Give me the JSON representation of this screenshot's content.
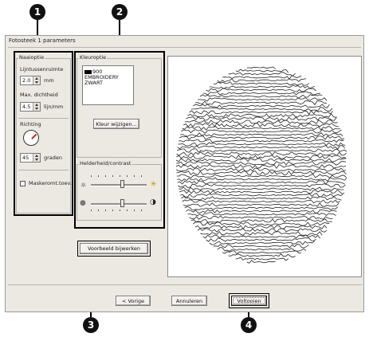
{
  "window": {
    "title": "Fotosteek 1 parameters"
  },
  "callouts": [
    "1",
    "2",
    "3",
    "4"
  ],
  "sewing": {
    "group_label": "Naaioptie",
    "line_spacing_label": "Lijntussenruimte",
    "line_spacing_value": "2.0",
    "line_spacing_unit": "mm",
    "max_density_label": "Max. dichtheid",
    "max_density_value": "4.5",
    "max_density_unit": "lijn/mm",
    "direction_label": "Richting",
    "angle_value": "45",
    "angle_unit": "graden",
    "mask_checkbox_label": "Maskeromt.toev.",
    "mask_checked": false
  },
  "color": {
    "group_label": "Kleuroptie",
    "list_lines": [
      "900",
      "EMBROIDERY",
      "ZWART"
    ],
    "swatch_color": "#000000",
    "change_button": "Kleur wijzigen..."
  },
  "brightness": {
    "group_label": "Helderheid/contrast",
    "brightness_level": 0.6,
    "contrast_level": 0.6
  },
  "update_button": "Voorbeeld bijwerken",
  "buttons": {
    "back": "< Vorige",
    "cancel": "Annuleren",
    "finish": "Voltooien"
  },
  "preview": {
    "description_color_background": "#ffffff",
    "ink": "#222222"
  }
}
